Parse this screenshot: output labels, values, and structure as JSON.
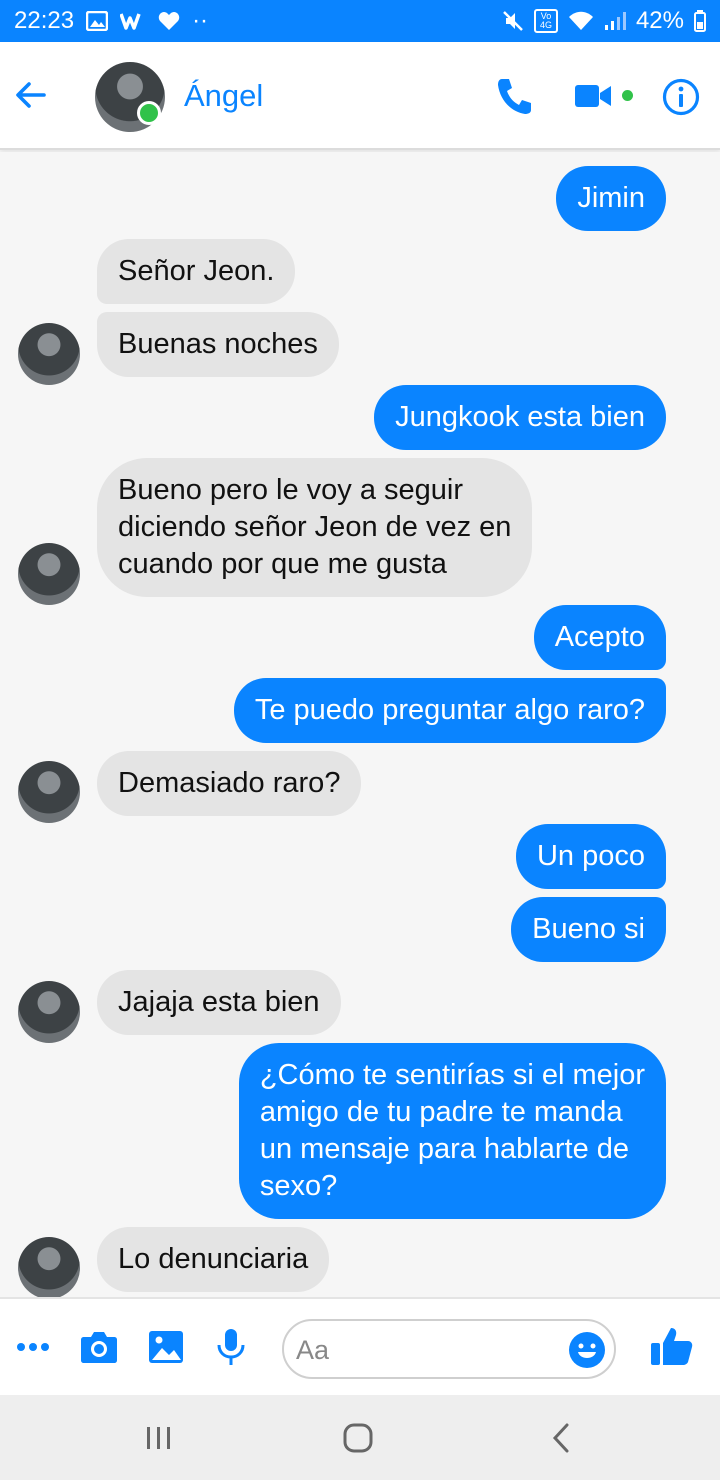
{
  "status_bar": {
    "time": "22:23",
    "battery": "42%",
    "dots": "··",
    "network": "Vo 4G"
  },
  "header": {
    "contact_name": "Ángel"
  },
  "messages": [
    {
      "dir": "sent",
      "text": "Jimin"
    },
    {
      "dir": "recv",
      "text": "Señor Jeon."
    },
    {
      "dir": "recv",
      "text": "Buenas noches"
    },
    {
      "dir": "sent",
      "text": "Jungkook esta bien"
    },
    {
      "dir": "recv",
      "text": "Bueno pero le voy a seguir\ndiciendo señor Jeon de vez en\ncuando por que me gusta"
    },
    {
      "dir": "sent",
      "text": "Acepto"
    },
    {
      "dir": "sent",
      "text": "Te puedo preguntar algo raro?"
    },
    {
      "dir": "recv",
      "text": "Demasiado raro?"
    },
    {
      "dir": "sent",
      "text": "Un poco"
    },
    {
      "dir": "sent",
      "text": "Bueno si"
    },
    {
      "dir": "recv",
      "text": "Jajaja esta bien"
    },
    {
      "dir": "sent",
      "text": "¿Cómo te sentirías si el mejor\namigo de tu padre te manda\nun mensaje para hablarte de\nsexo?"
    },
    {
      "dir": "recv",
      "text": "Lo denunciaria"
    }
  ],
  "composer": {
    "placeholder": "Aa"
  },
  "colors": {
    "accent": "#0a84ff",
    "online": "#31c24a",
    "received_bubble": "#e4e4e4"
  },
  "icons": [
    "back-arrow-icon",
    "phone-icon",
    "video-camera-icon",
    "info-icon",
    "more-icon",
    "camera-icon",
    "image-icon",
    "microphone-icon",
    "emoji-icon",
    "thumbs-up-icon",
    "recents-nav-icon",
    "home-nav-icon",
    "back-nav-icon"
  ]
}
